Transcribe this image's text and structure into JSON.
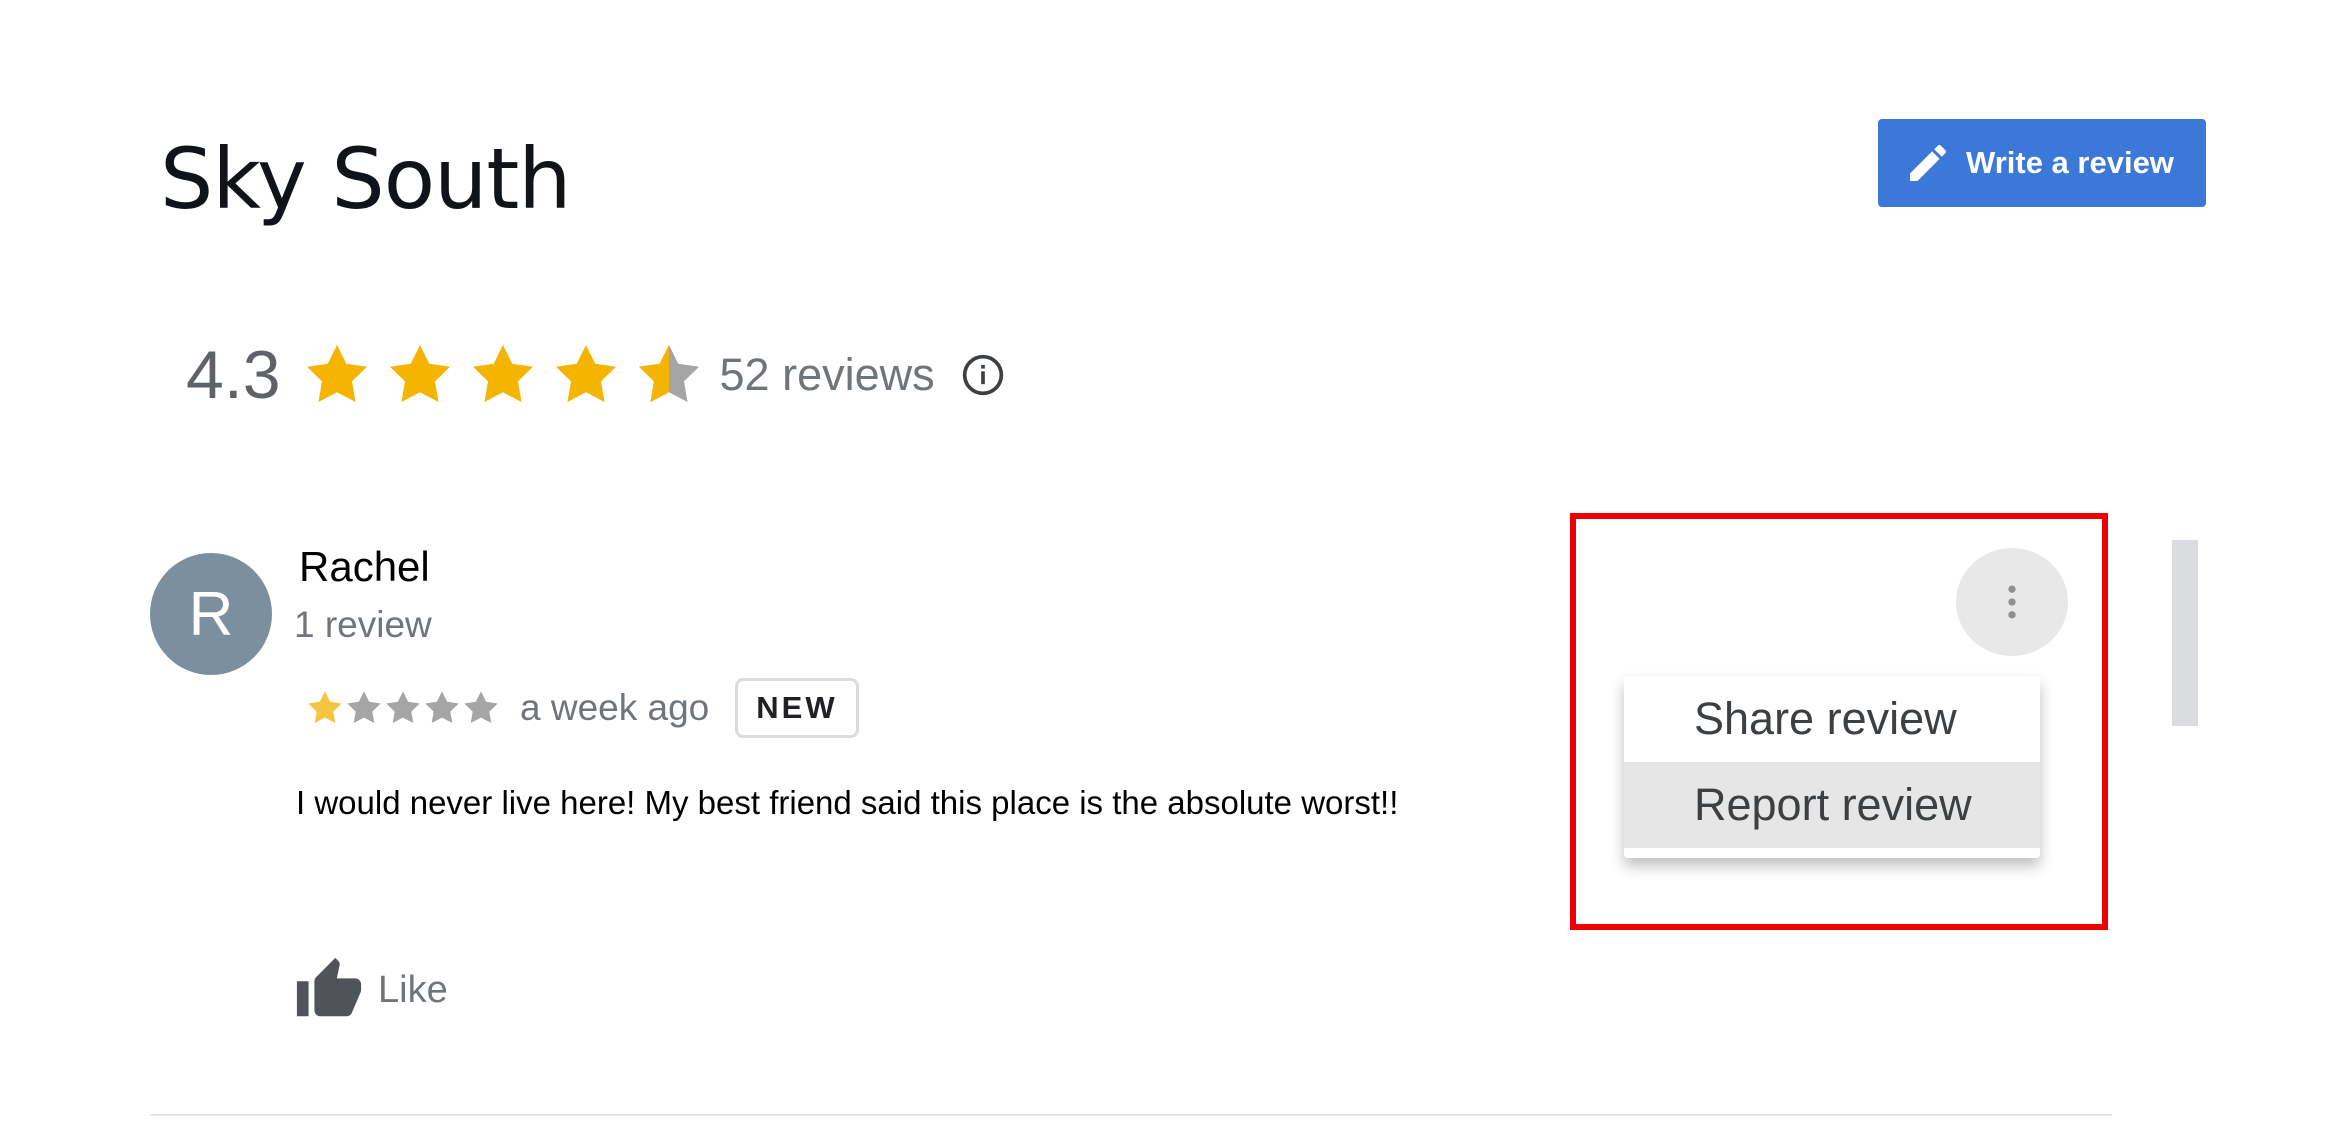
{
  "place": {
    "title": "Sky South"
  },
  "header": {
    "write_review_label": "Write a review"
  },
  "summary": {
    "rating": "4.3",
    "rating_value": 4.3,
    "review_count": "52 reviews"
  },
  "review": {
    "avatar_letter": "R",
    "author": "Rachel",
    "author_reviews": "1 review",
    "stars": 1,
    "time": "a week ago",
    "badge": "NEW",
    "text": "I would never live here! My best friend said this place is the absolute worst!!",
    "like_label": "Like"
  },
  "menu": {
    "items": [
      "Share review",
      "Report review"
    ],
    "highlighted_index": 1
  },
  "colors": {
    "accent": "#3c78d8",
    "star": "#f4b400",
    "highlight_box": "#ee0000"
  }
}
